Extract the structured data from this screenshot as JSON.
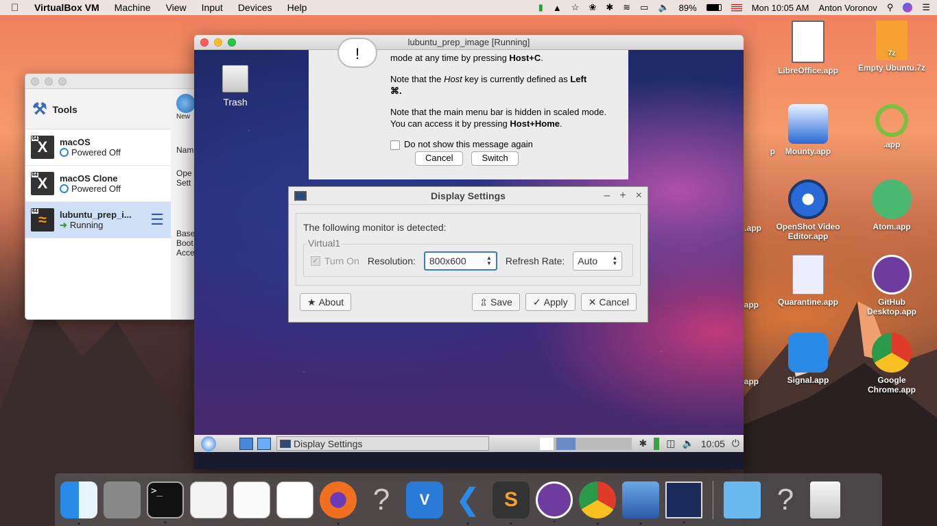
{
  "menubar": {
    "app": "VirtualBox VM",
    "items": [
      "Machine",
      "View",
      "Input",
      "Devices",
      "Help"
    ],
    "battery": "89%",
    "clock": "Mon 10:05 AM",
    "user": "Anton Voronov"
  },
  "vbox_manager": {
    "tools_label": "Tools",
    "new_label": "New",
    "vms": [
      {
        "name": "macOS",
        "state": "Powered Off"
      },
      {
        "name": "macOS Clone",
        "state": "Powered Off"
      },
      {
        "name": "lubuntu_prep_i...",
        "state": "Running"
      }
    ],
    "side_text": [
      "Nam",
      "Ope",
      "Sett",
      "Base",
      "Boot",
      "Acce"
    ]
  },
  "vm_window": {
    "title": "lubuntu_prep_image [Running]",
    "trash_label": "Trash",
    "info": {
      "line1": "mode at any time by pressing ",
      "line1_key": "Host+C",
      "line2a": "Note that the ",
      "line2_host": "Host",
      "line2b": " key is currently defined as ",
      "line2_key": "Left",
      "line2c": "⌘.",
      "line3": "Note that the main menu bar is hidden in scaled mode. You can access it by pressing ",
      "line3_key": "Host+Home",
      "checkbox": "Do not show this message again",
      "cancel": "Cancel",
      "switch": "Switch"
    },
    "display_settings": {
      "title": "Display Settings",
      "detected": "The following monitor is detected:",
      "group": "Virtual1",
      "turn_on": "Turn On",
      "resolution_label": "Resolution:",
      "resolution": "800x600",
      "refresh_label": "Refresh Rate:",
      "refresh": "Auto",
      "about": "About",
      "save": "Save",
      "apply": "Apply",
      "cancel": "Cancel"
    },
    "panel": {
      "task": "Display Settings",
      "clock": "10:05"
    }
  },
  "desktop_icons": [
    {
      "label": "LibreOffice.app"
    },
    {
      "label": "Empty Ubuntu.7z"
    },
    {
      "label": "Mounty.app"
    },
    {
      "label": ".app"
    },
    {
      "label": "OpenShot Video Editor.app"
    },
    {
      "label": "Atom.app"
    },
    {
      "label": "Quarantine.app"
    },
    {
      "label": "GitHub Desktop.app"
    },
    {
      "label": "Signal.app"
    },
    {
      "label": "Google Chrome.app"
    }
  ],
  "partial_labels": [
    "p",
    ".app",
    "app",
    "app"
  ],
  "sevenz": "7z",
  "colors": {
    "accent": "#3a78c8",
    "github": "#6e3b9e"
  }
}
